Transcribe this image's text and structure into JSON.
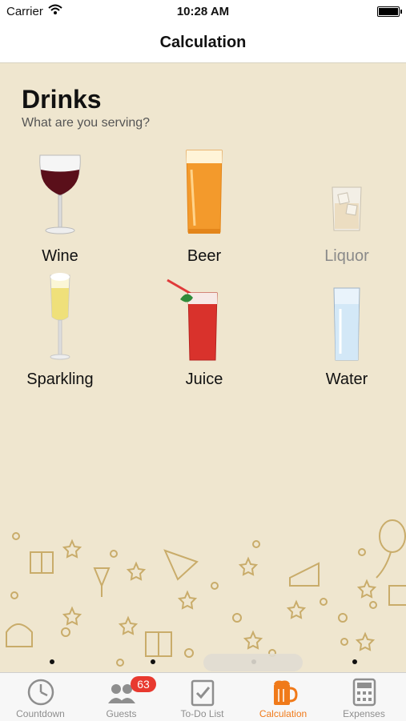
{
  "status_bar": {
    "carrier": "Carrier",
    "time": "10:28 AM"
  },
  "nav": {
    "title": "Calculation"
  },
  "section": {
    "title": "Drinks",
    "subtitle": "What are you serving?"
  },
  "drinks": [
    {
      "label": "Wine",
      "selected": true,
      "icon": "wine-glass-icon"
    },
    {
      "label": "Beer",
      "selected": true,
      "icon": "beer-glass-icon"
    },
    {
      "label": "Liquor",
      "selected": false,
      "icon": "liquor-glass-icon"
    },
    {
      "label": "Sparkling",
      "selected": true,
      "icon": "champagne-flute-icon"
    },
    {
      "label": "Juice",
      "selected": true,
      "icon": "juice-glass-icon"
    },
    {
      "label": "Water",
      "selected": true,
      "icon": "water-glass-icon"
    }
  ],
  "tabs": [
    {
      "label": "Countdown",
      "icon": "clock-icon"
    },
    {
      "label": "Guests",
      "icon": "guests-icon",
      "badge": "63"
    },
    {
      "label": "To-Do List",
      "icon": "checklist-icon"
    },
    {
      "label": "Calculation",
      "icon": "beer-mug-icon",
      "active": true
    },
    {
      "label": "Expenses",
      "icon": "calculator-icon"
    }
  ],
  "colors": {
    "accent": "#f07a1a",
    "background": "#efe6cf",
    "badge": "#e8392f",
    "decor": "#c9ac6a"
  }
}
